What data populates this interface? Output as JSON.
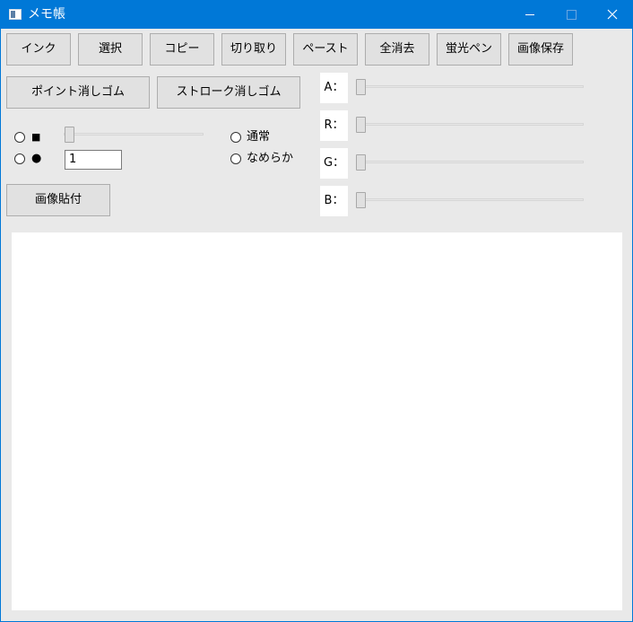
{
  "window": {
    "title": "メモ帳"
  },
  "toolbar": {
    "buttons": [
      {
        "label": "インク"
      },
      {
        "label": "選択"
      },
      {
        "label": "コピー"
      },
      {
        "label": "切り取り"
      },
      {
        "label": "ペースト"
      },
      {
        "label": "全消去"
      },
      {
        "label": "蛍光ペン"
      },
      {
        "label": "画像保存"
      }
    ]
  },
  "eraser": {
    "point_label": "ポイント消しゴム",
    "stroke_label": "ストローク消しゴム"
  },
  "pen": {
    "tip_options": [
      {
        "label": "■",
        "selected": false
      },
      {
        "label": "●",
        "selected": false
      }
    ],
    "size_value": "1",
    "size_level": 0.0,
    "smoothing_options": [
      {
        "label": "通常",
        "selected": false
      },
      {
        "label": "なめらか",
        "selected": false
      }
    ]
  },
  "color": {
    "channels": [
      {
        "label": "A：",
        "value": 0
      },
      {
        "label": "R：",
        "value": 0
      },
      {
        "label": "G：",
        "value": 0
      },
      {
        "label": "B：",
        "value": 0
      }
    ]
  },
  "paste_image": {
    "label": "画像貼付"
  }
}
